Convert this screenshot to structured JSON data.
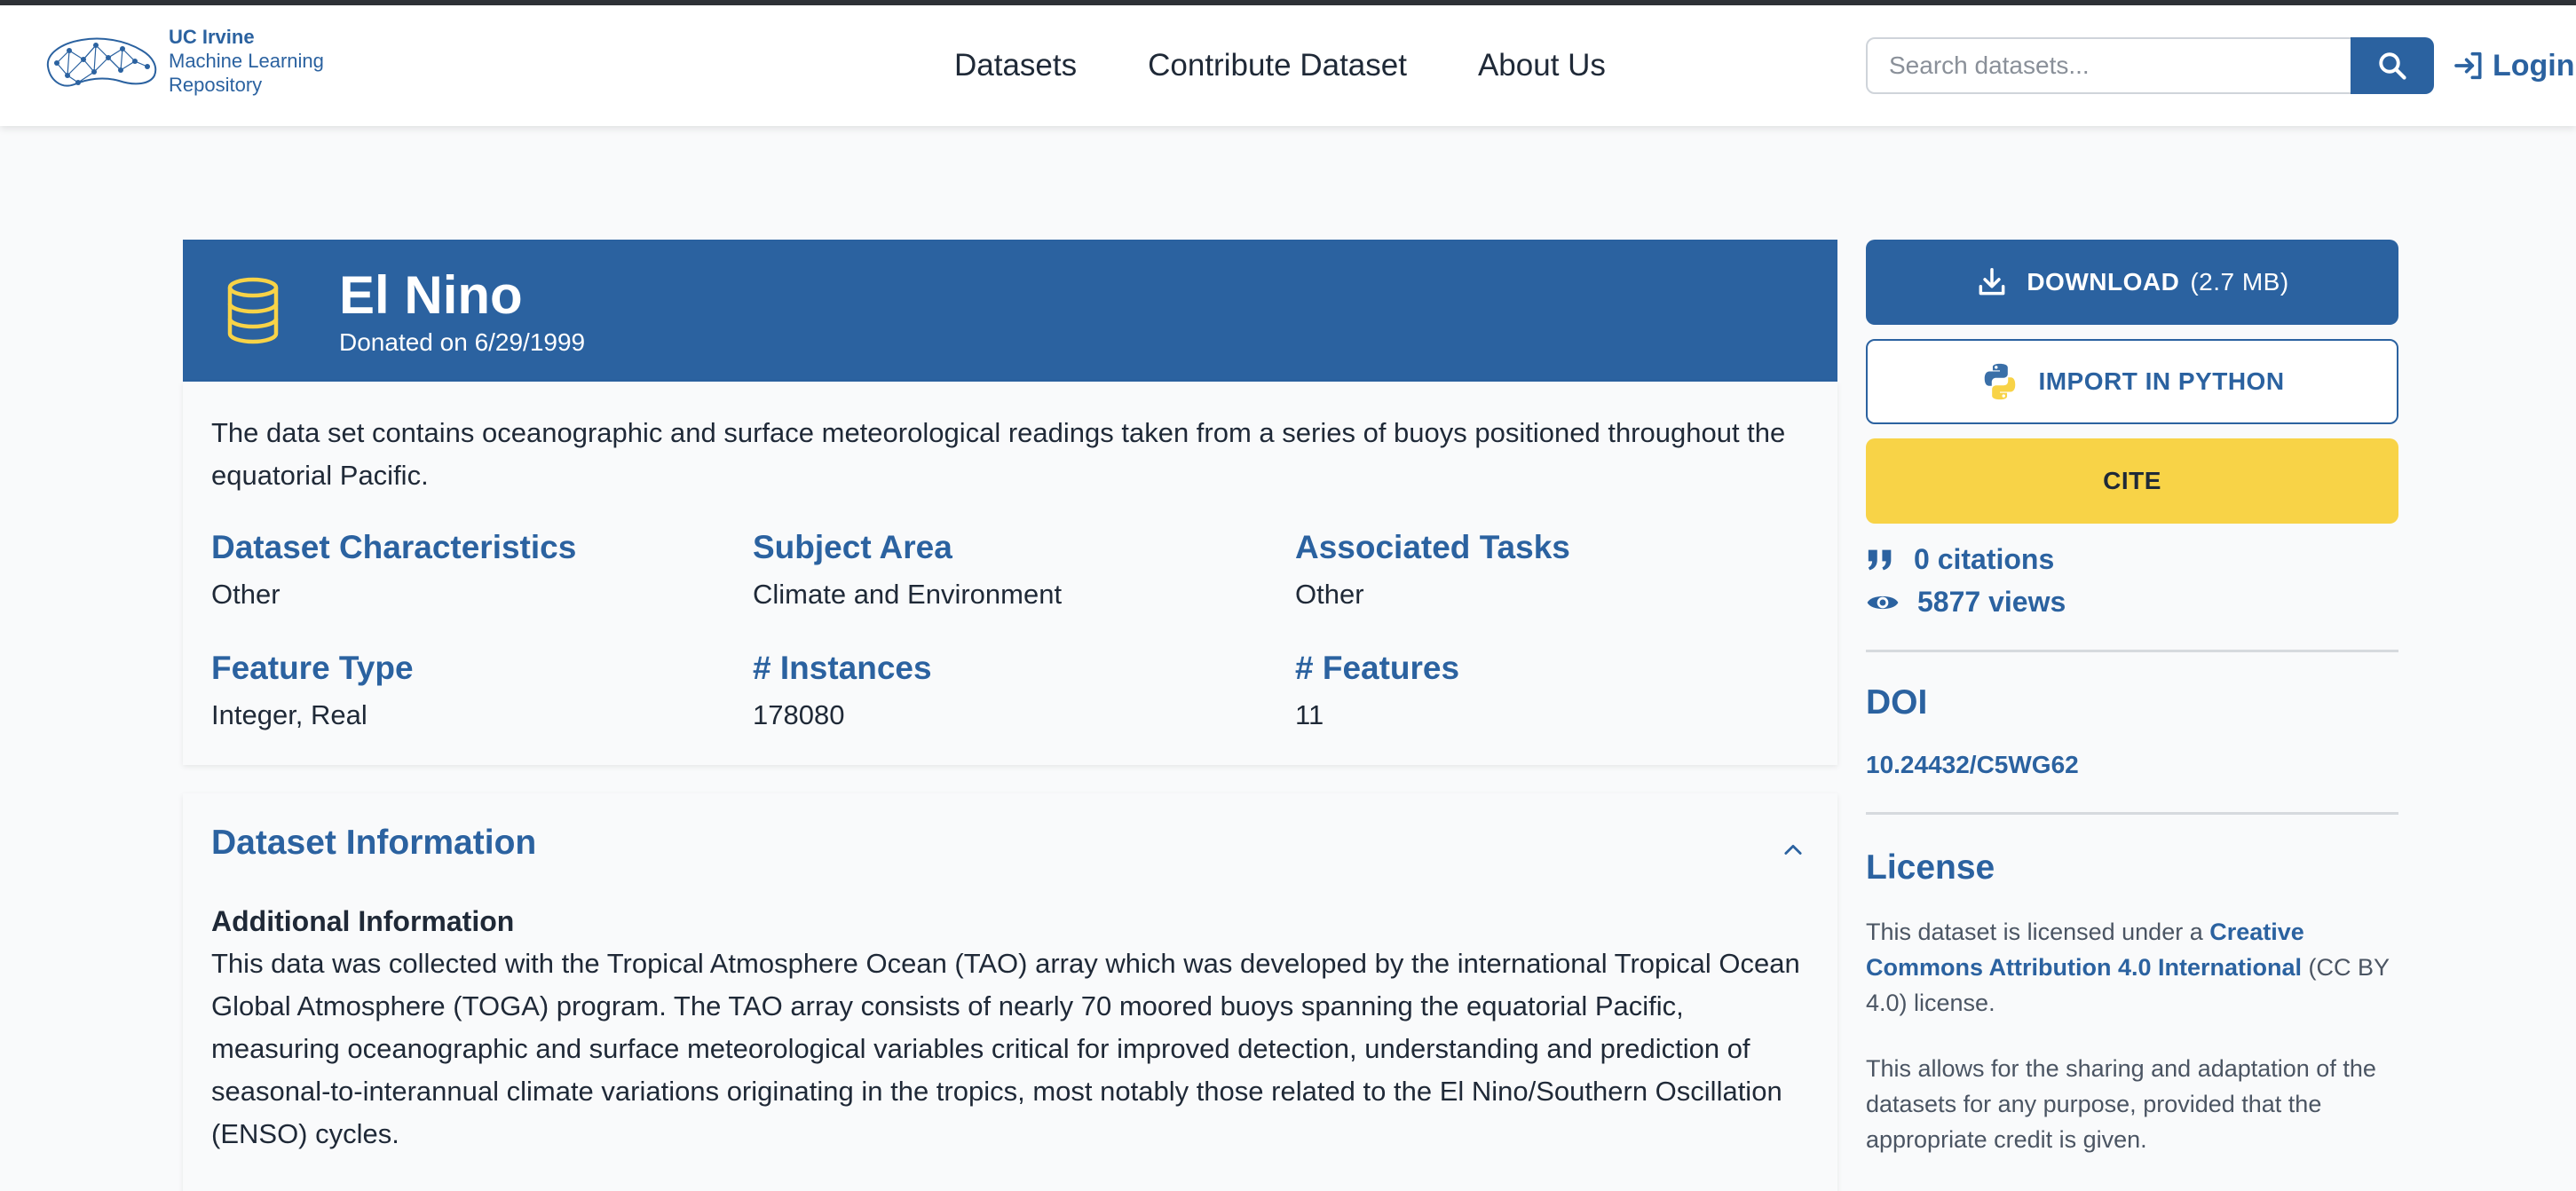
{
  "colors": {
    "primary": "#2b62a0",
    "accent": "#f8d347",
    "text": "#1f2937",
    "muted": "#4b5563"
  },
  "brand": {
    "line1": "UC Irvine",
    "line2": "Machine Learning",
    "line3": "Repository",
    "icon": "repository-logo-icon"
  },
  "nav": {
    "items": [
      "Datasets",
      "Contribute Dataset",
      "About Us"
    ]
  },
  "search": {
    "placeholder": "Search datasets...",
    "icon": "search-icon"
  },
  "login": {
    "label": "Login",
    "icon": "login-icon"
  },
  "dataset": {
    "icon": "database-icon",
    "title": "El Nino",
    "donated": "Donated on 6/29/1999",
    "abstract": "The data set contains oceanographic and surface meteorological readings taken from a series of buoys positioned throughout the equatorial Pacific.",
    "meta": [
      {
        "key": "Dataset Characteristics",
        "value": "Other"
      },
      {
        "key": "Subject Area",
        "value": "Climate and Environment"
      },
      {
        "key": "Associated Tasks",
        "value": "Other"
      },
      {
        "key": "Feature Type",
        "value": "Integer, Real"
      },
      {
        "key": "# Instances",
        "value": "178080"
      },
      {
        "key": "# Features",
        "value": "11"
      }
    ]
  },
  "info": {
    "title": "Dataset Information",
    "additional_title": "Additional Information",
    "additional_body": "This data was collected with the Tropical Atmosphere Ocean (TAO) array which was developed by the international Tropical Ocean Global Atmosphere (TOGA) program. The TAO array consists of nearly 70 moored buoys spanning the equatorial Pacific, measuring oceanographic and surface meteorological variables critical for improved detection, understanding and prediction of seasonal-to-interannual climate variations originating in the tropics, most notably those related to the El Nino/Southern Oscillation (ENSO) cycles."
  },
  "actions": {
    "download_label": "DOWNLOAD",
    "download_size": "(2.7 MB)",
    "python_label": "IMPORT IN PYTHON",
    "cite_label": "CITE"
  },
  "stats": {
    "citations": "0 citations",
    "views": "5877 views"
  },
  "doi": {
    "heading": "DOI",
    "value": "10.24432/C5WG62"
  },
  "license": {
    "heading": "License",
    "p1_before": "This dataset is licensed under a ",
    "p1_link": "Creative Commons Attribution 4.0 International",
    "p1_after": " (CC BY 4.0) license.",
    "p2": "This allows for the sharing and adaptation of the datasets for any purpose, provided that the appropriate credit is given."
  }
}
